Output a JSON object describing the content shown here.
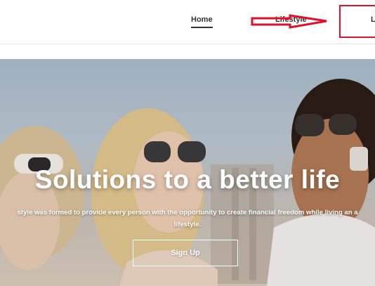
{
  "nav": {
    "items": [
      {
        "label": "Home",
        "active": true
      },
      {
        "label": "Lifestyle",
        "active": false
      },
      {
        "label": "L",
        "active": false
      }
    ]
  },
  "hero": {
    "title": "Solutions to a better life",
    "subtitle_line1": "style was formed to provide every person with the opportunity to create financial freedom while living an a",
    "subtitle_line2": "lifestyle.",
    "button_label": "Sign Up"
  },
  "colors": {
    "annotation": "#e0102a",
    "nav_text": "#333333",
    "hero_text": "#ffffff"
  }
}
